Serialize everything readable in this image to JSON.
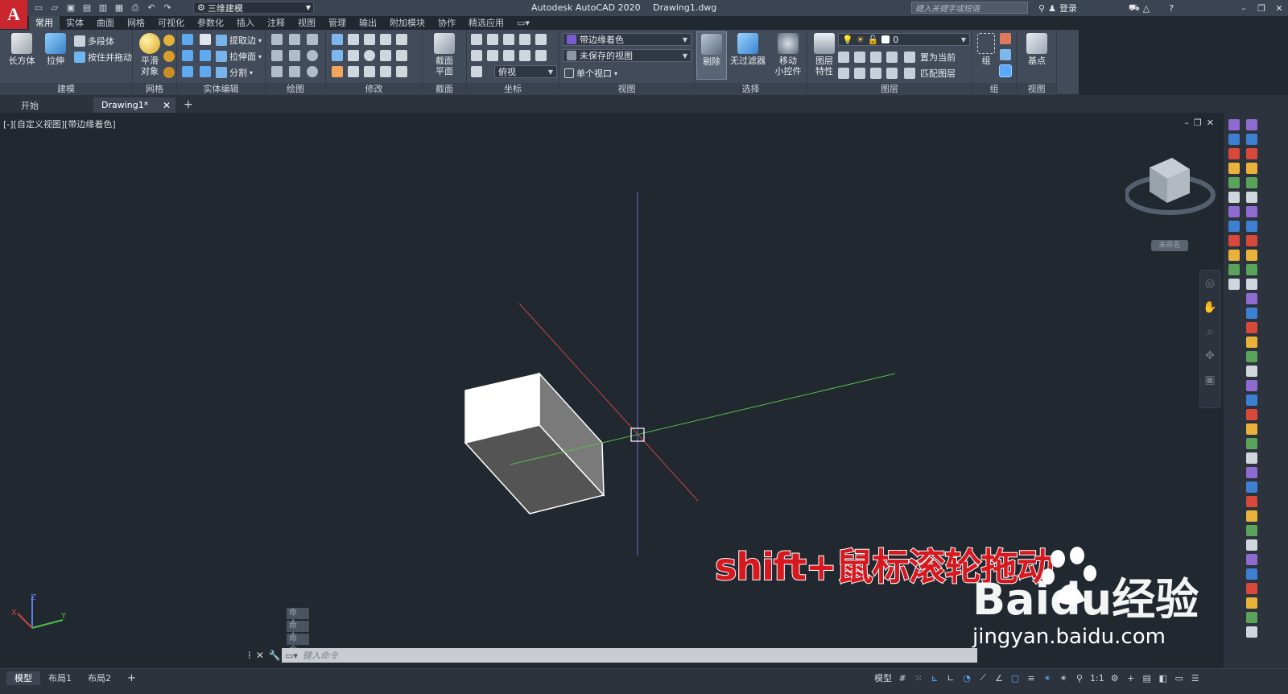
{
  "app": {
    "logo": "A",
    "title": "Autodesk AutoCAD 2020",
    "file": "Drawing1.dwg",
    "workspace": "三维建模",
    "search_placeholder": "键入关键字或短语",
    "login": "登录"
  },
  "ribbon_tabs": [
    "常用",
    "实体",
    "曲面",
    "网格",
    "可视化",
    "参数化",
    "插入",
    "注释",
    "视图",
    "管理",
    "输出",
    "附加模块",
    "协作",
    "精选应用"
  ],
  "ribbon": {
    "modeling": {
      "title": "建模",
      "box": "长方体",
      "extrude": "拉伸",
      "polysolid": "多段体",
      "presspull": "按住并拖动"
    },
    "mesh": {
      "title": "网格",
      "smooth_l1": "平滑",
      "smooth_l2": "对象"
    },
    "solid_edit": {
      "title": "实体编辑",
      "extract": "提取边",
      "extrude_face": "拉伸面",
      "separate": "分割"
    },
    "draw": {
      "title": "绘图"
    },
    "modify": {
      "title": "修改"
    },
    "section": {
      "title": "截面",
      "plane_l1": "截面",
      "plane_l2": "平面"
    },
    "coords": {
      "title": "坐标",
      "view_dd": "俯视"
    },
    "view": {
      "title": "视图",
      "visual_style": "带边缘着色",
      "saved_view": "未保存的视图",
      "viewport": "单个视口"
    },
    "selection": {
      "title": "选择",
      "cull": "剔除",
      "no_filter": "无过滤器",
      "gizmo_l1": "移动",
      "gizmo_l2": "小控件"
    },
    "layers": {
      "title": "图层",
      "props_l1": "图层",
      "props_l2": "特性",
      "current_layer": "0",
      "set_current": "置为当前",
      "match_layer": "匹配图层"
    },
    "groups": {
      "title": "组",
      "group": "组"
    },
    "view2": {
      "title": "视图",
      "base": "基点"
    }
  },
  "doc_tabs": {
    "start": "开始",
    "drawing": "Drawing1*"
  },
  "viewport": {
    "label": "[-][自定义视图][带边缘着色]",
    "wcs_badge": "未命名"
  },
  "overlay": {
    "caption": "shift+鼠标滚轮拖动",
    "watermark_logo": "Baidu经验",
    "watermark_url": "jingyan.baidu.com"
  },
  "command": {
    "history": [
      "命令:",
      "命令:",
      "命令:"
    ],
    "placeholder": "键入命令"
  },
  "layout_tabs": [
    "模型",
    "布局1",
    "布局2"
  ],
  "status": {
    "model": "模型",
    "scale": "1:1"
  },
  "colors": {
    "background": "#212830",
    "ribbon": "#424b5a",
    "x_axis": "#c0474a",
    "y_axis": "#55c14a",
    "z_axis": "#6a6ad8",
    "caption": "#d7191f"
  }
}
